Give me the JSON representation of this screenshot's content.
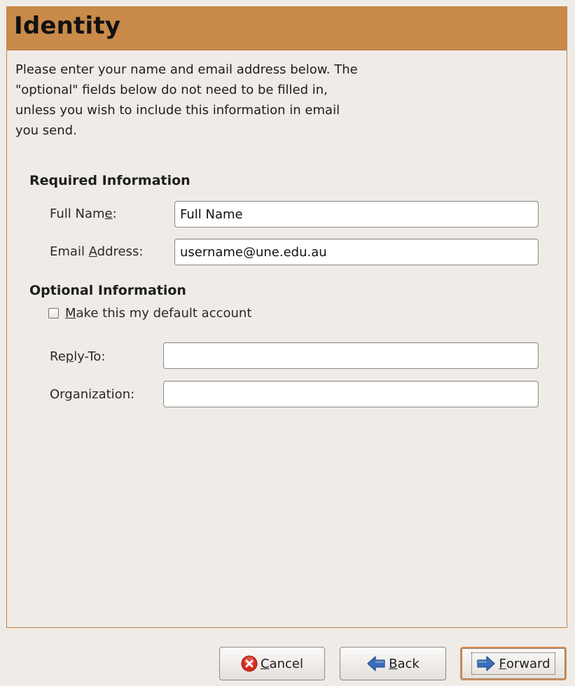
{
  "page": {
    "title": "Identity",
    "intro_lines": [
      "Please enter your name and email address below. The",
      "\"optional\" fields below do not need to be filled in,",
      "unless you wish to include this information in email",
      "you send."
    ]
  },
  "required": {
    "heading": "Required Information",
    "full_name": {
      "label_pre": "Full Nam",
      "label_mn": "e",
      "label_post": ":",
      "value": "Full Name"
    },
    "email": {
      "label_pre": "Email ",
      "label_mn": "A",
      "label_post": "ddress:",
      "value": "username@une.edu.au"
    }
  },
  "optional": {
    "heading": "Optional Information",
    "default_account": {
      "label_mn": "M",
      "label_post": "ake this my default account",
      "checked": false
    },
    "reply_to": {
      "label_pre": "Re",
      "label_mn": "p",
      "label_post": "ly-To:",
      "value": ""
    },
    "organization": {
      "label_pre": "Or",
      "label_mn": "g",
      "label_post": "anization:",
      "value": ""
    }
  },
  "buttons": {
    "cancel": {
      "label_mn": "C",
      "label_post": "ancel",
      "icon": "cancel-icon"
    },
    "back": {
      "label_mn": "B",
      "label_post": "ack",
      "icon": "back-arrow-icon"
    },
    "forward": {
      "label_mn": "F",
      "label_post": "orward",
      "icon": "forward-arrow-icon"
    }
  },
  "colors": {
    "header_accent": "#c98a4a",
    "arrow_blue": "#3a6fb8",
    "cancel_red": "#d42b1c"
  }
}
